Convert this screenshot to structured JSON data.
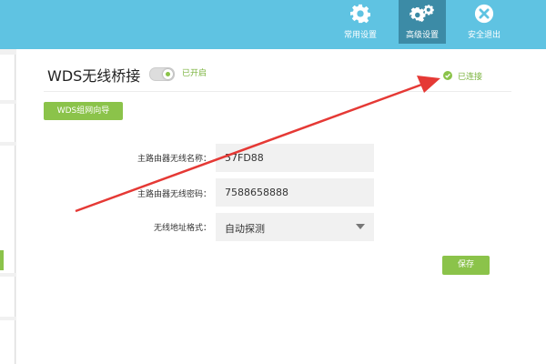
{
  "nav": {
    "common": "常用设置",
    "advanced": "高级设置",
    "logout": "安全退出"
  },
  "wds": {
    "title": "WDS无线桥接",
    "toggle_state": "已开启",
    "connection_status": "已连接",
    "wizard_label": "WDS组网向导"
  },
  "form": {
    "ssid_label": "主路由器无线名称：",
    "ssid_value": "57FD88",
    "password_label": "主路由器无线密码：",
    "password_value": "7588658888",
    "address_label": "无线地址格式：",
    "address_value": "自动探测",
    "save_label": "保存"
  },
  "colors": {
    "header": "#5fc3e2",
    "header_active": "#3c8ba6",
    "accent_green": "#8bc34a",
    "annotation_arrow": "#e53935"
  }
}
